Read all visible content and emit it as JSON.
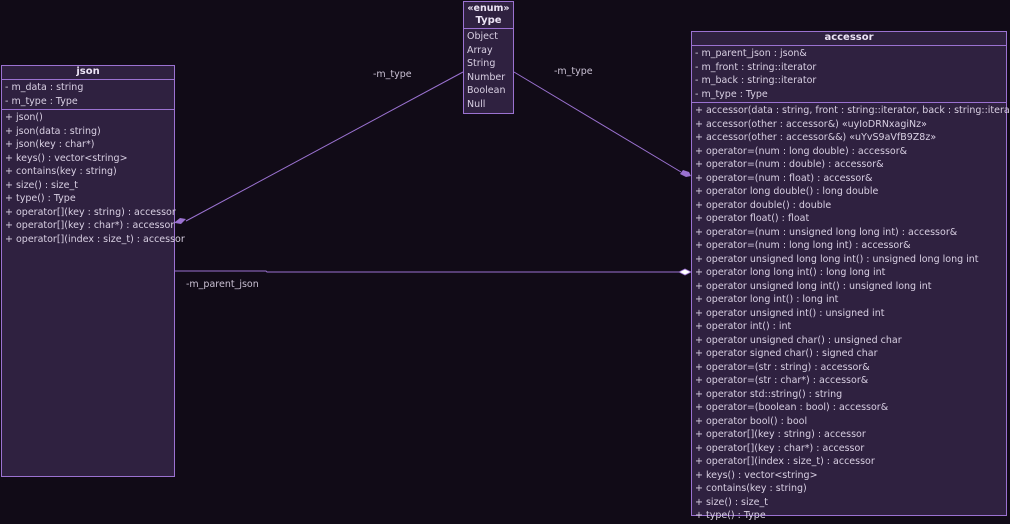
{
  "colors": {
    "background": "#110b17",
    "box_fill": "#2f2140",
    "border": "#9b72d1",
    "text": "#d9d0e3"
  },
  "json_class": {
    "name": "json",
    "attributes": [
      "- m_data : string",
      "- m_type : Type"
    ],
    "operations": [
      "+ json()",
      "+ json(data : string)",
      "+ json(key : char*)",
      "+ keys() : vector<string>",
      "+ contains(key : string)",
      "+ size() : size_t",
      "+ type() : Type",
      "+ operator[](key : string) : accessor",
      "+ operator[](key : char*) : accessor",
      "+ operator[](index : size_t) : accessor"
    ]
  },
  "type_enum": {
    "stereotype": "«enum»",
    "name": "Type",
    "literals": [
      "Object",
      "Array",
      "String",
      "Number",
      "Boolean",
      "Null"
    ]
  },
  "accessor_class": {
    "name": "accessor",
    "attributes": [
      "- m_parent_json : json&",
      "- m_front : string::iterator",
      "- m_back : string::iterator",
      "- m_type : Type"
    ],
    "operations": [
      "+ accessor(data : string, front : string::iterator, back : string::iterator)",
      "+ accessor(other : accessor&) «uyIoDRNxagiNz»",
      "+ accessor(other : accessor&&) «uYvS9aVfB9Z8z»",
      "+ operator=(num : long double) : accessor&",
      "+ operator=(num : double) : accessor&",
      "+ operator=(num : float) : accessor&",
      "+ operator long double() : long double",
      "+ operator double() : double",
      "+ operator float() : float",
      "+ operator=(num : unsigned long long int) : accessor&",
      "+ operator=(num : long long int) : accessor&",
      "+ operator unsigned long long int() : unsigned long long int",
      "+ operator long long int() : long long int",
      "+ operator unsigned long int() : unsigned long int",
      "+ operator long int() : long int",
      "+ operator unsigned int() : unsigned int",
      "+ operator int() : int",
      "+ operator unsigned char() : unsigned char",
      "+ operator signed char() : signed char",
      "+ operator=(str : string) : accessor&",
      "+ operator=(str : char*) : accessor&",
      "+ operator std::string() : string",
      "+ operator=(boolean : bool) : accessor&",
      "+ operator bool() : bool",
      "+ operator[](key : string) : accessor",
      "+ operator[](key : char*) : accessor",
      "+ operator[](index : size_t) : accessor",
      "+ keys() : vector<string>",
      "+ contains(key : string)",
      "+ size() : size_t",
      "+ type() : Type"
    ]
  },
  "edges": {
    "json_type_label": "-m_type",
    "accessor_type_label": "-m_type",
    "parent_json_label": "-m_parent_json"
  }
}
